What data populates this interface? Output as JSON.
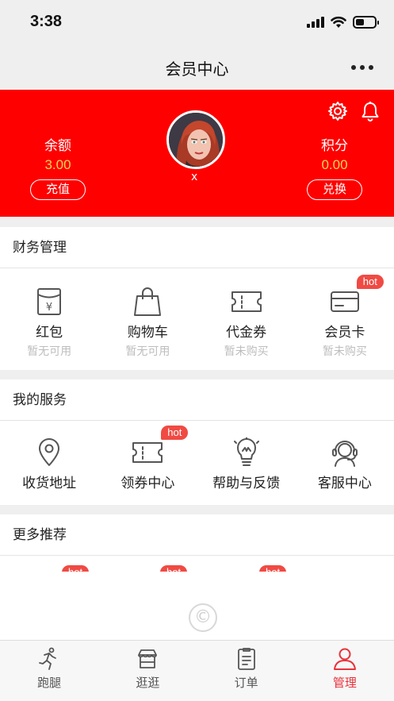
{
  "status_bar": {
    "time": "3:38"
  },
  "nav": {
    "title": "会员中心"
  },
  "header": {
    "balance": {
      "label": "余额",
      "value": "3.00",
      "button": "充值"
    },
    "points": {
      "label": "积分",
      "value": "0.00",
      "button": "兑换"
    },
    "avatar_caption": "x",
    "colors": {
      "background": "#fe0000",
      "value": "#ffd35a"
    }
  },
  "finance": {
    "title": "财务管理",
    "items": [
      {
        "label": "红包",
        "sub": "暂无可用",
        "icon": "red-envelope-icon"
      },
      {
        "label": "购物车",
        "sub": "暂无可用",
        "icon": "shopping-bag-icon"
      },
      {
        "label": "代金券",
        "sub": "暂未购买",
        "icon": "voucher-icon"
      },
      {
        "label": "会员卡",
        "sub": "暂未购买",
        "icon": "member-card-icon",
        "badge": "hot"
      }
    ]
  },
  "services": {
    "title": "我的服务",
    "items": [
      {
        "label": "收货地址",
        "icon": "location-pin-icon"
      },
      {
        "label": "领券中心",
        "icon": "coupon-icon",
        "badge": "hot"
      },
      {
        "label": "帮助与反馈",
        "icon": "lightbulb-icon"
      },
      {
        "label": "客服中心",
        "icon": "customer-service-icon"
      }
    ]
  },
  "recommend": {
    "title": "更多推荐",
    "badges": [
      "hot",
      "hot",
      "hot"
    ],
    "footer_mark": "©"
  },
  "tabs": [
    {
      "label": "跑腿",
      "icon": "runner-icon"
    },
    {
      "label": "逛逛",
      "icon": "store-icon"
    },
    {
      "label": "订单",
      "icon": "order-icon"
    },
    {
      "label": "管理",
      "icon": "user-icon",
      "active": true
    }
  ],
  "accent_color": "#e8333b"
}
